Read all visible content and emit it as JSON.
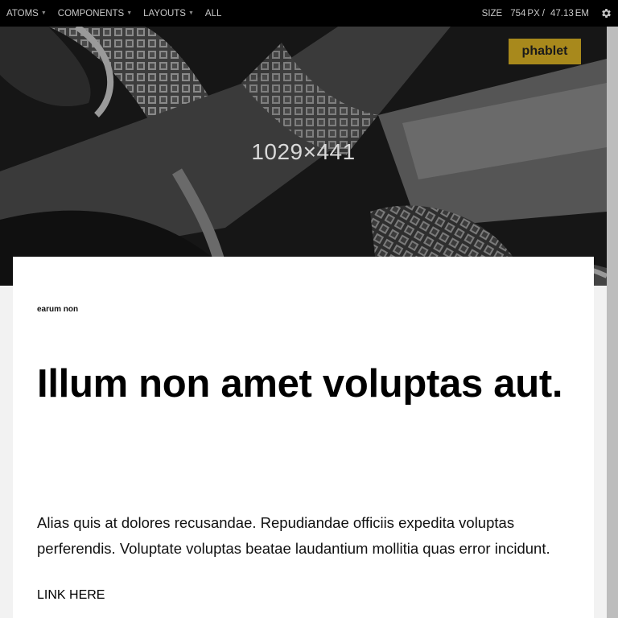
{
  "toolbar": {
    "nav": [
      {
        "label": "ATOMS",
        "has_menu": true
      },
      {
        "label": "COMPONENTS",
        "has_menu": true
      },
      {
        "label": "LAYOUTS",
        "has_menu": true
      },
      {
        "label": "ALL",
        "has_menu": false
      }
    ],
    "size_label": "SIZE",
    "size_px": "754",
    "size_px_unit": "PX",
    "size_separator": "/",
    "size_em": "47.13",
    "size_em_unit": "EM",
    "settings_icon": "gear-icon",
    "menu_arrow_icon": "caret-down-icon"
  },
  "hero": {
    "image_dimensions_text": "1029×441",
    "breakpoint_badge": "phablet"
  },
  "card": {
    "eyebrow": "earum non",
    "headline": "Illum non amet voluptas aut.",
    "body": "Alias quis at dolores recusandae. Repudiandae officiis expedita voluptas perferendis. Voluptate voluptas beatae laudantium mollitia quas error incidunt.",
    "link": "LINK HERE"
  },
  "colors": {
    "toolbar_bg": "#000000",
    "toolbar_text": "#c8c8c8",
    "badge_bg": "#a8891c",
    "hero_bg": "#141414",
    "card_bg": "#ffffff",
    "page_bg": "#f2f2f2"
  }
}
